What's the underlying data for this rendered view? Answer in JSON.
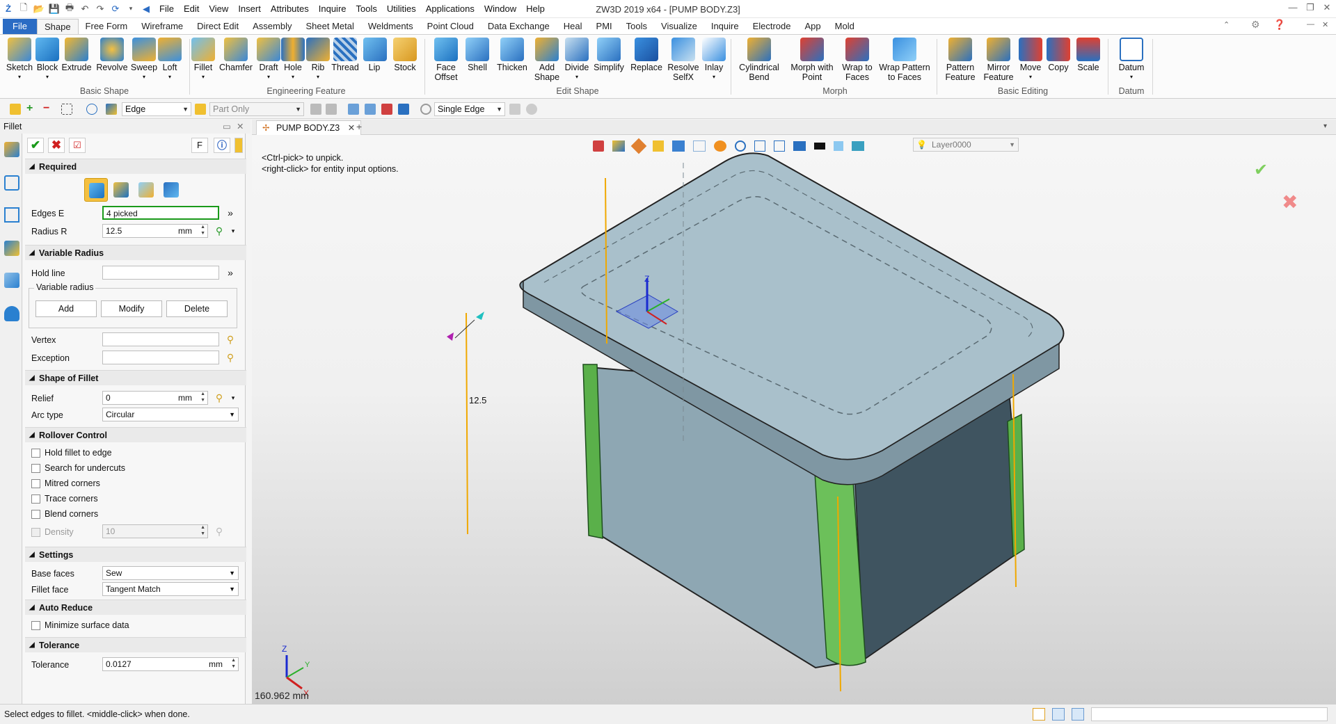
{
  "titlebar": {
    "title": "ZW3D 2019  x64 - [PUMP BODY.Z3]",
    "menus": [
      "File",
      "Edit",
      "View",
      "Insert",
      "Attributes",
      "Inquire",
      "Tools",
      "Utilities",
      "Applications",
      "Window",
      "Help"
    ]
  },
  "ribbon_tabs": [
    "File",
    "Shape",
    "Free Form",
    "Wireframe",
    "Direct Edit",
    "Assembly",
    "Sheet Metal",
    "Weldments",
    "Point Cloud",
    "Data Exchange",
    "Heal",
    "PMI",
    "Tools",
    "Visualize",
    "Inquire",
    "Electrode",
    "App",
    "Mold"
  ],
  "ribbon": {
    "groups": {
      "basic_shape": "Basic Shape",
      "engineering_feature": "Engineering Feature",
      "edit_shape": "Edit Shape",
      "morph": "Morph",
      "basic_editing": "Basic Editing",
      "datum": "Datum"
    },
    "buttons": {
      "sketch": "Sketch",
      "block": "Block",
      "extrude": "Extrude",
      "revolve": "Revolve",
      "sweep": "Sweep",
      "loft": "Loft",
      "fillet": "Fillet",
      "chamfer": "Chamfer",
      "draft": "Draft",
      "hole": "Hole",
      "rib": "Rib",
      "thread": "Thread",
      "lip": "Lip",
      "stock": "Stock",
      "face_offset_1": "Face",
      "face_offset_2": "Offset",
      "shell": "Shell",
      "thicken": "Thicken",
      "add_shape_1": "Add",
      "add_shape_2": "Shape",
      "divide": "Divide",
      "simplify": "Simplify",
      "replace": "Replace",
      "resolve_1": "Resolve",
      "resolve_2": "SelfX",
      "inlay": "Inlay",
      "cyl_bend_1": "Cylindrical",
      "cyl_bend_2": "Bend",
      "morph_point_1": "Morph with",
      "morph_point_2": "Point",
      "wrap_faces_1": "Wrap to",
      "wrap_faces_2": "Faces",
      "wrap_pattern_1": "Wrap Pattern",
      "wrap_pattern_2": "to Faces",
      "pattern_1": "Pattern",
      "pattern_2": "Feature",
      "mirror_1": "Mirror",
      "mirror_2": "Feature",
      "move": "Move",
      "copy": "Copy",
      "scale": "Scale",
      "datum": "Datum"
    }
  },
  "toolbar2": {
    "filter_value": "Edge",
    "scope_value": "Part Only",
    "pick_mode_value": "Single Edge"
  },
  "panel": {
    "title": "Fillet",
    "sections": {
      "required": "Required",
      "variable_radius": "Variable Radius",
      "shape_of_fillet": "Shape of Fillet",
      "rollover": "Rollover Control",
      "settings": "Settings",
      "auto_reduce": "Auto Reduce",
      "tolerance": "Tolerance"
    },
    "edges_label": "Edges E",
    "edges_value": "4 picked",
    "radius_label": "Radius R",
    "radius_value": "12.5",
    "unit": "mm",
    "hold_line_label": "Hold line",
    "variable_radius_group": "Variable radius",
    "add_btn": "Add",
    "modify_btn": "Modify",
    "delete_btn": "Delete",
    "vertex_label": "Vertex",
    "exception_label": "Exception",
    "relief_label": "Relief",
    "relief_value": "0",
    "arc_type_label": "Arc type",
    "arc_type_value": "Circular",
    "checks": [
      "Hold fillet to edge",
      "Search for undercuts",
      "Mitred corners",
      "Trace corners",
      "Blend corners"
    ],
    "density_label": "Density",
    "density_value": "10",
    "base_faces_label": "Base faces",
    "base_faces_value": "Sew",
    "fillet_face_label": "Fillet face",
    "fillet_face_value": "Tangent Match",
    "minimize_label": "Minimize surface data",
    "tolerance_label": "Tolerance",
    "tolerance_value": "0.0127",
    "f_button": "F"
  },
  "doc_tab": "PUMP BODY.Z3",
  "viewport": {
    "hint_1": "<Ctrl-pick> to unpick.",
    "hint_2": "<right-click> for entity input options.",
    "layer": "Layer0000",
    "dimension_label": "12.5",
    "scale_readout": "160.962 mm",
    "triad_x": "X",
    "triad_y": "Y",
    "triad_z": "Z"
  },
  "status": {
    "prompt": "Select edges to fillet.  <middle-click> when done."
  },
  "colors": {
    "accent_blue": "#2b6cc4",
    "body_face": "#a9c0cb",
    "fillet_green": "#5ab04a",
    "edge_orange": "#f0a800"
  }
}
